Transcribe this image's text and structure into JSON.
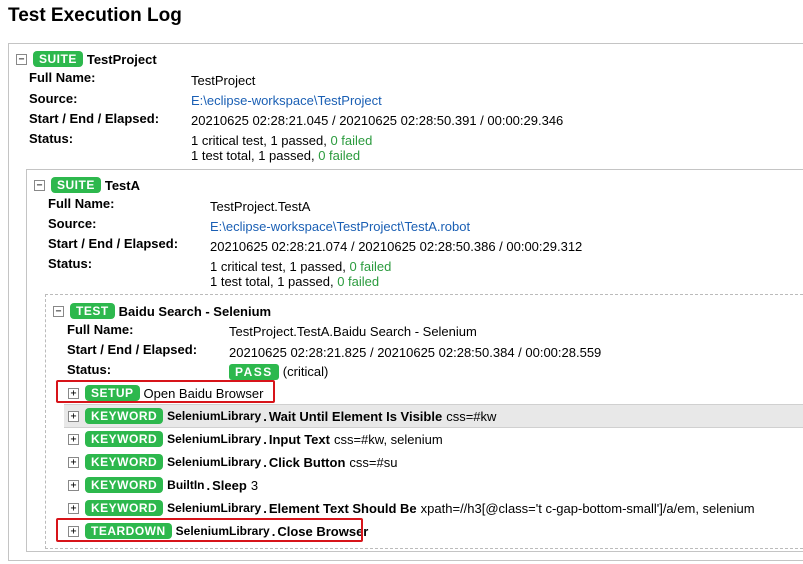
{
  "page": {
    "title": "Test Execution Log"
  },
  "suite1": {
    "toggle": "−",
    "badge": "SUITE",
    "name": "TestProject",
    "labels": {
      "full_name": "Full Name:",
      "source": "Source:",
      "times": "Start / End / Elapsed:",
      "status": "Status:"
    },
    "full_name": "TestProject",
    "source": "E:\\eclipse-workspace\\TestProject",
    "times": "20210625 02:28:21.045 / 20210625 02:28:50.391 / 00:00:29.346",
    "status_line1_prefix": "1 critical test, 1 passed, ",
    "status_line1_failed": "0 failed",
    "status_line2_prefix": "1 test total, 1 passed, ",
    "status_line2_failed": "0 failed"
  },
  "suite2": {
    "toggle": "−",
    "badge": "SUITE",
    "name": "TestA",
    "labels": {
      "full_name": "Full Name:",
      "source": "Source:",
      "times": "Start / End / Elapsed:",
      "status": "Status:"
    },
    "full_name": "TestProject.TestA",
    "source": "E:\\eclipse-workspace\\TestProject\\TestA.robot",
    "times": "20210625 02:28:21.074 / 20210625 02:28:50.386 / 00:00:29.312",
    "status_line1_prefix": "1 critical test, 1 passed, ",
    "status_line1_failed": "0 failed",
    "status_line2_prefix": "1 test total, 1 passed, ",
    "status_line2_failed": "0 failed"
  },
  "test": {
    "toggle": "−",
    "badge": "TEST",
    "name": "Baidu Search - Selenium",
    "labels": {
      "full_name": "Full Name:",
      "times": "Start / End / Elapsed:",
      "status": "Status:"
    },
    "full_name": "TestProject.TestA.Baidu Search - Selenium",
    "times": "20210625 02:28:21.825 / 20210625 02:28:50.384 / 00:00:28.559",
    "status_badge": "PASS",
    "status_note": "(critical)"
  },
  "keywords": [
    {
      "toggle": "+",
      "badge": "SETUP",
      "owner": "",
      "dot": "",
      "name": "",
      "args": "Open Baidu Browser"
    },
    {
      "toggle": "+",
      "badge": "KEYWORD",
      "owner": "SeleniumLibrary",
      "dot": ".",
      "name": "Wait Until Element Is Visible",
      "args": "css=#kw"
    },
    {
      "toggle": "+",
      "badge": "KEYWORD",
      "owner": "SeleniumLibrary",
      "dot": ".",
      "name": "Input Text",
      "args": "css=#kw, selenium"
    },
    {
      "toggle": "+",
      "badge": "KEYWORD",
      "owner": "SeleniumLibrary",
      "dot": ".",
      "name": "Click Button",
      "args": "css=#su"
    },
    {
      "toggle": "+",
      "badge": "KEYWORD",
      "owner": "BuiltIn",
      "dot": ".",
      "name": "Sleep",
      "args": "3"
    },
    {
      "toggle": "+",
      "badge": "KEYWORD",
      "owner": "SeleniumLibrary",
      "dot": ".",
      "name": "Element Text Should Be",
      "args": "xpath=//h3[@class='t c-gap-bottom-small']/a/em, selenium"
    },
    {
      "toggle": "+",
      "badge": "TEARDOWN",
      "owner": "SeleniumLibrary",
      "dot": ".",
      "name": "Close Browser",
      "args": ""
    }
  ],
  "colors": {
    "accent_green": "#2db84d",
    "link_blue": "#1a5fb4",
    "highlight_red": "#d7141a"
  }
}
